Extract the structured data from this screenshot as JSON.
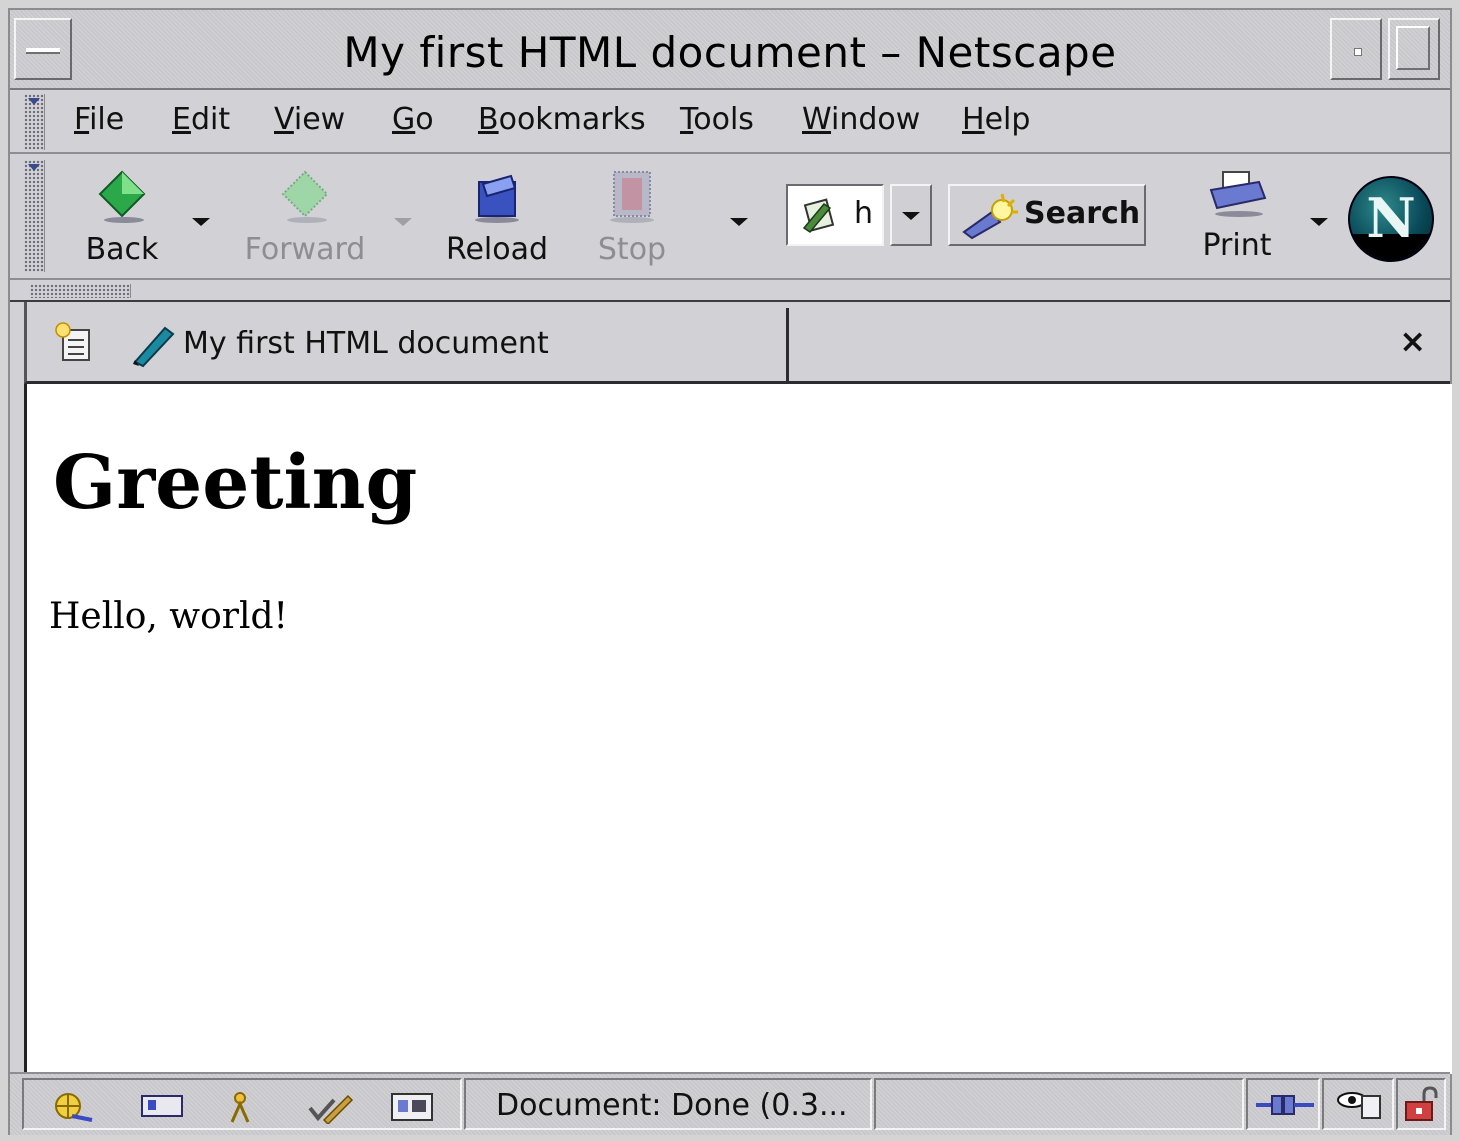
{
  "window": {
    "title": "My first HTML document – Netscape"
  },
  "menubar": {
    "items": [
      {
        "label": "File",
        "u": "F",
        "rest": "ile"
      },
      {
        "label": "Edit",
        "u": "E",
        "rest": "dit"
      },
      {
        "label": "View",
        "u": "V",
        "rest": "iew"
      },
      {
        "label": "Go",
        "u": "G",
        "rest": "o"
      },
      {
        "label": "Bookmarks",
        "u": "B",
        "rest": "ookmarks"
      },
      {
        "label": "Tools",
        "u": "T",
        "rest": "ools"
      },
      {
        "label": "Window",
        "u": "W",
        "rest": "indow"
      },
      {
        "label": "Help",
        "u": "H",
        "rest": "elp"
      }
    ]
  },
  "toolbar": {
    "back_label": "Back",
    "forward_label": "Forward",
    "reload_label": "Reload",
    "stop_label": "Stop",
    "url_value": "h",
    "search_label": "Search",
    "print_label": "Print"
  },
  "tabs": {
    "active_label": "My first HTML document",
    "close_glyph": "×"
  },
  "content": {
    "heading": "Greeting",
    "paragraph": "Hello, world!"
  },
  "statusbar": {
    "status_text": "Document: Done (0.3..."
  },
  "colors": {
    "chrome": "#d2d2d6",
    "page": "#ffffff",
    "logo": "#0a4a5a"
  }
}
